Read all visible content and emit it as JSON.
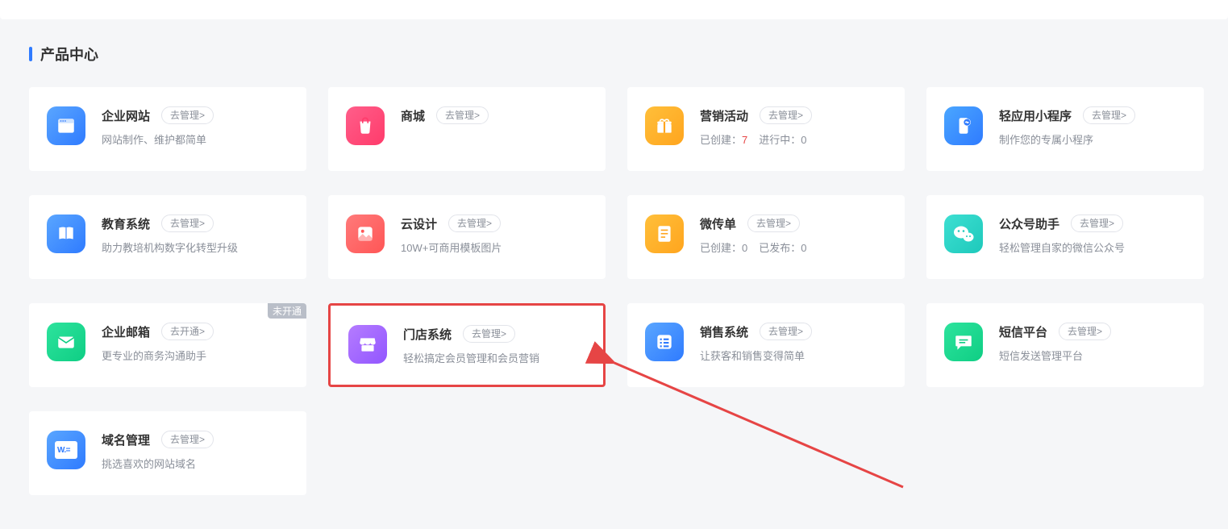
{
  "section_title": "产品中心",
  "badge_unopened": "未开通",
  "products": {
    "website": {
      "title": "企业网站",
      "button": "去管理>",
      "desc": "网站制作、维护都简单"
    },
    "shop": {
      "title": "商城",
      "button": "去管理>",
      "desc": ""
    },
    "activity": {
      "title": "营销活动",
      "button": "去管理>",
      "stat1_label": "已创建：",
      "stat1_value": "7",
      "stat2_label": "进行中：",
      "stat2_value": "0"
    },
    "miniapp": {
      "title": "轻应用小程序",
      "button": "去管理>",
      "desc": "制作您的专属小程序"
    },
    "edu": {
      "title": "教育系统",
      "button": "去管理>",
      "desc": "助力教培机构数字化转型升级"
    },
    "design": {
      "title": "云设计",
      "button": "去管理>",
      "desc": "10W+可商用模板图片"
    },
    "flyer": {
      "title": "微传单",
      "button": "去管理>",
      "stat1_label": "已创建：",
      "stat1_value": "0",
      "stat2_label": "已发布：",
      "stat2_value": "0"
    },
    "wechat": {
      "title": "公众号助手",
      "button": "去管理>",
      "desc": "轻松管理自家的微信公众号"
    },
    "mail": {
      "title": "企业邮箱",
      "button": "去开通>",
      "desc": "更专业的商务沟通助手"
    },
    "store": {
      "title": "门店系统",
      "button": "去管理>",
      "desc": "轻松搞定会员管理和会员营销"
    },
    "sales": {
      "title": "销售系统",
      "button": "去管理>",
      "desc": "让获客和销售变得简单"
    },
    "sms": {
      "title": "短信平台",
      "button": "去管理>",
      "desc": "短信发送管理平台"
    },
    "domain": {
      "title": "域名管理",
      "button": "去管理>",
      "desc": "挑选喜欢的网站域名",
      "icon_text": "W.="
    }
  }
}
